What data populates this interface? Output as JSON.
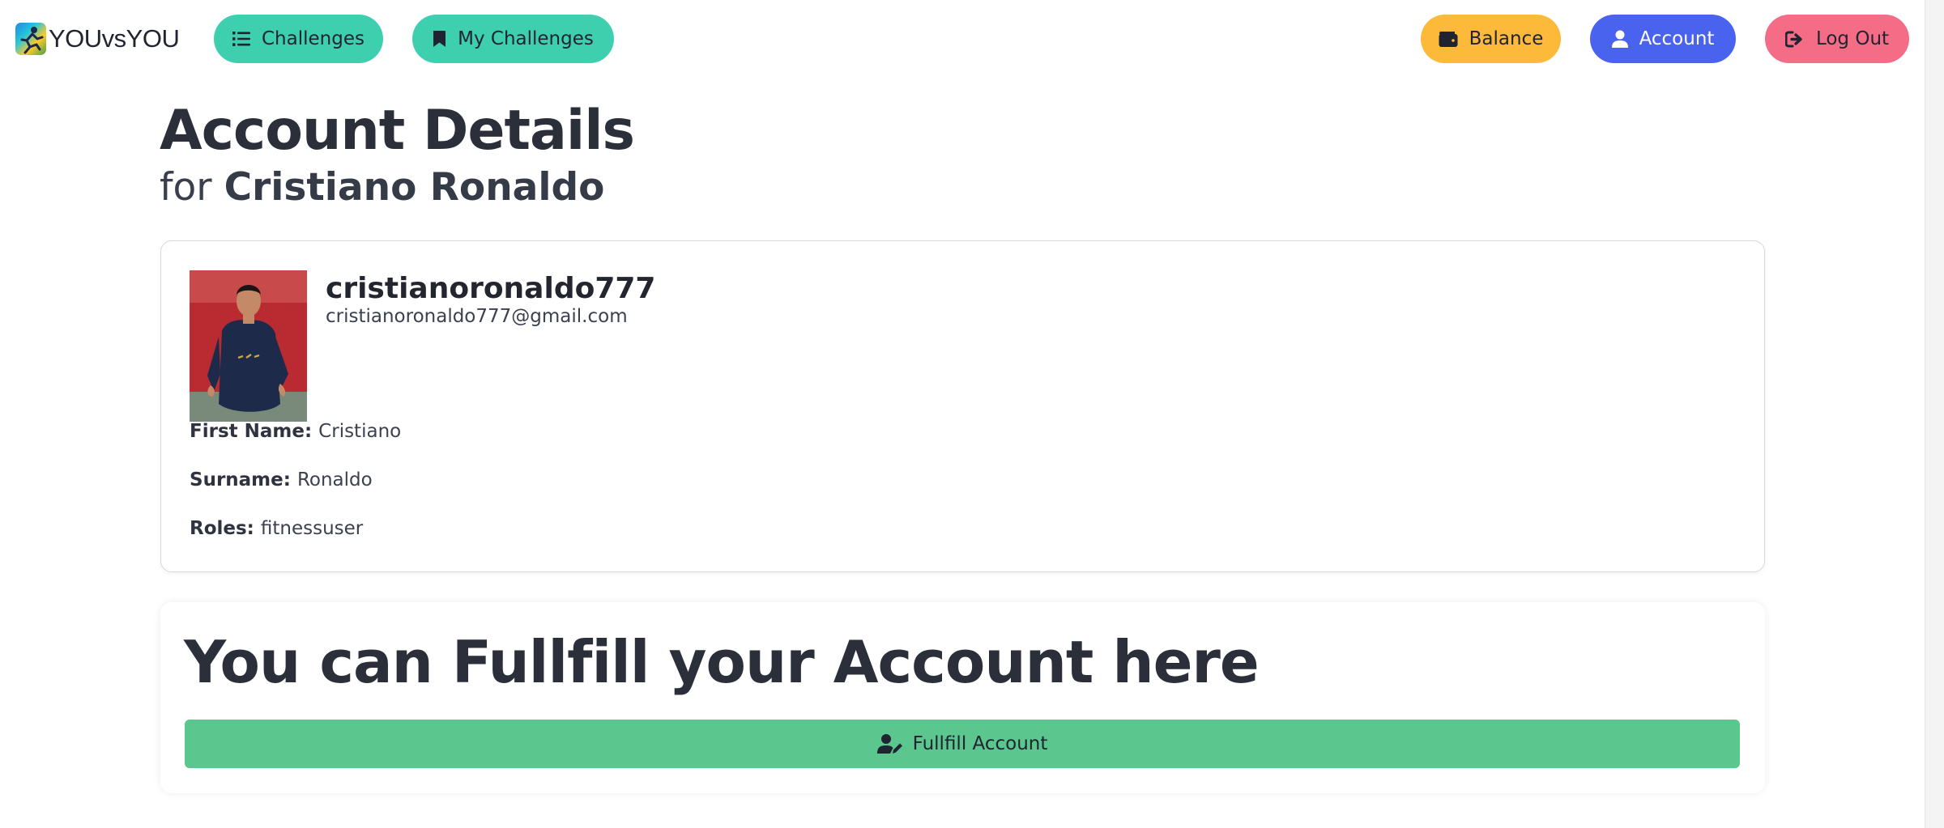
{
  "brand": {
    "name": "YOUvsYOU",
    "logo_icon": "runner-logo-icon"
  },
  "nav": {
    "challenges_label": "Challenges",
    "my_challenges_label": "My Challenges",
    "balance_label": "Balance",
    "account_label": "Account",
    "logout_label": "Log Out"
  },
  "colors": {
    "teal": "#3dcfae",
    "yellow": "#fdb93a",
    "blue": "#4a63ee",
    "pink": "#f56c86",
    "green": "#5bc68e"
  },
  "header": {
    "title": "Account Details",
    "subtitle_prefix": "for",
    "subtitle_name": "Cristiano Ronaldo"
  },
  "profile": {
    "username": "cristianoronaldo777",
    "email": "cristianoronaldo777@gmail.com",
    "first_name_label": "First Name:",
    "first_name": "Cristiano",
    "surname_label": "Surname:",
    "surname": "Ronaldo",
    "roles_label": "Roles:",
    "roles": "fitnessuser"
  },
  "fulfill": {
    "title": "You can Fullfill your Account here",
    "button_label": "Fullfill Account"
  }
}
